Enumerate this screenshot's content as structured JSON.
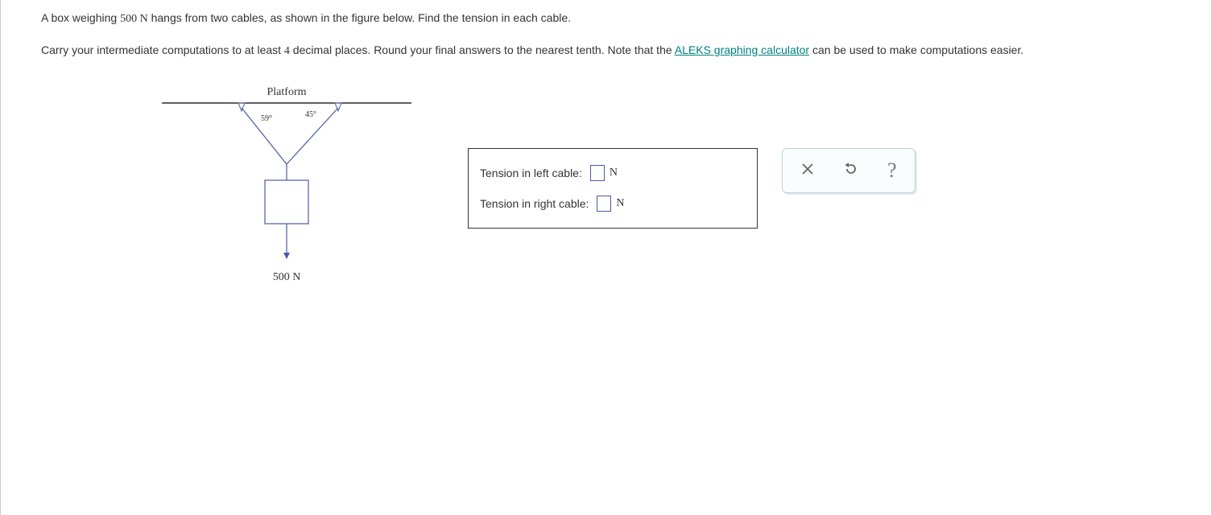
{
  "problem": {
    "intro_pre": "A box weighing ",
    "weight": "500 N",
    "intro_post": " hangs from two cables, as shown in the figure below. Find the tension in each cable.",
    "instr_pre": "Carry your intermediate computations to at least ",
    "decimals": "4",
    "instr_mid": " decimal places. Round your final answers to the nearest tenth. Note that the ",
    "calc_link": "ALEKS graphing calculator",
    "instr_post": " can be used to make computations easier."
  },
  "diagram": {
    "platform_label": "Platform",
    "angle_left": "59°",
    "angle_right": "45°",
    "weight_label": "500 N"
  },
  "answers": {
    "left_label": "Tension in left cable:",
    "right_label": "Tension in right cable:",
    "unit": "N"
  },
  "toolbar": {
    "clear_title": "Clear",
    "reset_title": "Reset",
    "help_title": "Help",
    "help_glyph": "?"
  }
}
